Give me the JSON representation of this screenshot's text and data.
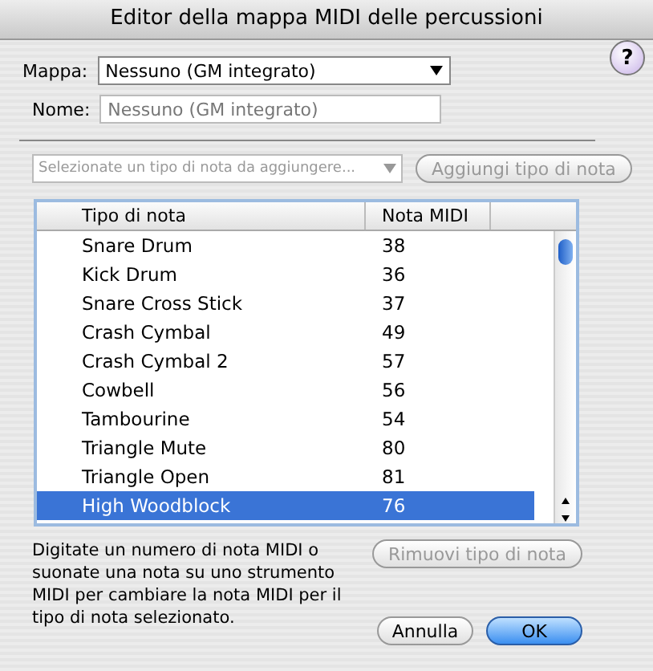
{
  "window": {
    "title": "Editor della mappa MIDI delle percussioni",
    "help": "?"
  },
  "map": {
    "label": "Mappa:",
    "value": "Nessuno (GM integrato)"
  },
  "name": {
    "label": "Nome:",
    "placeholder": "Nessuno (GM integrato)"
  },
  "add": {
    "dropdown": "Selezionate un tipo di nota da aggiungere...",
    "dropdown_disabled": true,
    "button": "Aggiungi tipo di nota",
    "button_disabled": true
  },
  "table": {
    "columns": [
      "Tipo di nota",
      "Nota MIDI"
    ],
    "rows": [
      {
        "name": "Snare Drum",
        "midi": "38",
        "selected": false
      },
      {
        "name": "Kick Drum",
        "midi": "36",
        "selected": false
      },
      {
        "name": "Snare Cross Stick",
        "midi": "37",
        "selected": false
      },
      {
        "name": "Crash Cymbal",
        "midi": "49",
        "selected": false
      },
      {
        "name": "Crash Cymbal 2",
        "midi": "57",
        "selected": false
      },
      {
        "name": "Cowbell",
        "midi": "56",
        "selected": false
      },
      {
        "name": "Tambourine",
        "midi": "54",
        "selected": false
      },
      {
        "name": "Triangle Mute",
        "midi": "80",
        "selected": false
      },
      {
        "name": "Triangle Open",
        "midi": "81",
        "selected": false
      },
      {
        "name": "High Woodblock",
        "midi": "76",
        "selected": true
      }
    ]
  },
  "hint": "Digitate un numero di nota MIDI o suonate una nota su uno strumento MIDI per cambiare la nota MIDI per il tipo di nota selezionato.",
  "remove": {
    "label": "Rimuovi tipo di nota",
    "disabled": true
  },
  "buttons": [
    {
      "label": "Annulla",
      "kind": "cancel"
    },
    {
      "label": "OK",
      "kind": "default"
    }
  ]
}
